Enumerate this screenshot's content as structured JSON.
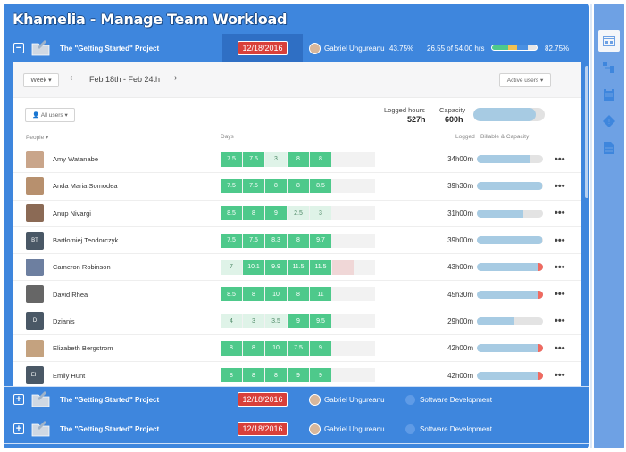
{
  "app": {
    "title": "Khamelia - Manage Team Workload"
  },
  "projects": [
    {
      "toggle": "−",
      "name": "The \"Getting Started\" Project",
      "date": "12/18/2016",
      "owner": "Gabriel Ungureanu",
      "percent": "43.75%",
      "hours": "26.55 of 54.00 hrs",
      "budget_pct": "82.75%",
      "budget_segments": {
        "green": 0.35,
        "yellow": 0.2,
        "blue": 0.25
      }
    },
    {
      "toggle": "+",
      "name": "The \"Getting Started\" Project",
      "date": "12/18/2016",
      "owner": "Gabriel Ungureanu",
      "department": "Software Development"
    },
    {
      "toggle": "+",
      "name": "The \"Getting Started\" Project",
      "date": "12/18/2016",
      "owner": "Gabriel Ungureanu",
      "department": "Software Development"
    }
  ],
  "toolbar": {
    "week_label": "Week ▾",
    "prev": "‹",
    "next": "›",
    "range": "Feb 18th - Feb 24th",
    "active_users": "Active users ▾"
  },
  "filters": {
    "all_users": "👤 All users ▾"
  },
  "summary": {
    "logged_label": "Logged hours",
    "logged_value": "527h",
    "capacity_label": "Capacity",
    "capacity_value": "600h",
    "capacity_fill": 0.88
  },
  "columns": {
    "people": "People ▾",
    "days": "Days",
    "logged": "Logged",
    "billable": "Billable & Capacity"
  },
  "people": [
    {
      "name": "Amy Watanabe",
      "initials": "",
      "avatar_color": "#c9a58a",
      "days": [
        {
          "v": "7.5",
          "s": "full"
        },
        {
          "v": "7.5",
          "s": "full"
        },
        {
          "v": "3",
          "s": "part"
        },
        {
          "v": "8",
          "s": "full"
        },
        {
          "v": "8",
          "s": "full"
        }
      ],
      "logged": "34h00m",
      "bar": 0.8,
      "over": false
    },
    {
      "name": "Anda Maria Somodea",
      "initials": "",
      "avatar_color": "#b7906e",
      "days": [
        {
          "v": "7.5",
          "s": "full"
        },
        {
          "v": "7.5",
          "s": "full"
        },
        {
          "v": "8",
          "s": "full"
        },
        {
          "v": "8",
          "s": "full"
        },
        {
          "v": "8.5",
          "s": "full"
        }
      ],
      "logged": "39h30m",
      "bar": 0.98,
      "over": false
    },
    {
      "name": "Anup Nivargi",
      "initials": "",
      "avatar_color": "#8b6a55",
      "days": [
        {
          "v": "8.5",
          "s": "full"
        },
        {
          "v": "8",
          "s": "full"
        },
        {
          "v": "9",
          "s": "full"
        },
        {
          "v": "2.5",
          "s": "part"
        },
        {
          "v": "3",
          "s": "part"
        }
      ],
      "logged": "31h00m",
      "bar": 0.7,
      "over": false
    },
    {
      "name": "Bartłomiej Teodorczyk",
      "initials": "BT",
      "avatar_color": "#4a5866",
      "days": [
        {
          "v": "7.5",
          "s": "full"
        },
        {
          "v": "7.5",
          "s": "full"
        },
        {
          "v": "8.3",
          "s": "full"
        },
        {
          "v": "8",
          "s": "full"
        },
        {
          "v": "9.7",
          "s": "full"
        }
      ],
      "logged": "39h00m",
      "bar": 0.98,
      "over": false
    },
    {
      "name": "Cameron Robinson",
      "initials": "",
      "avatar_color": "#6d7fa0",
      "days": [
        {
          "v": "7",
          "s": "part"
        },
        {
          "v": "10.1",
          "s": "full"
        },
        {
          "v": "9.9",
          "s": "full"
        },
        {
          "v": "11.5",
          "s": "full"
        },
        {
          "v": "11.5",
          "s": "full"
        },
        {
          "v": "",
          "s": "over"
        }
      ],
      "logged": "43h00m",
      "bar": 1.0,
      "over": true
    },
    {
      "name": "David Rhea",
      "initials": "",
      "avatar_color": "#666666",
      "days": [
        {
          "v": "8.5",
          "s": "full"
        },
        {
          "v": "8",
          "s": "full"
        },
        {
          "v": "10",
          "s": "full"
        },
        {
          "v": "8",
          "s": "full"
        },
        {
          "v": "11",
          "s": "full"
        }
      ],
      "logged": "45h30m",
      "bar": 1.0,
      "over": true
    },
    {
      "name": "Dzianis",
      "initials": "D",
      "avatar_color": "#4a5866",
      "days": [
        {
          "v": "4",
          "s": "part"
        },
        {
          "v": "3",
          "s": "part"
        },
        {
          "v": "3.5",
          "s": "part"
        },
        {
          "v": "9",
          "s": "full"
        },
        {
          "v": "9.5",
          "s": "full"
        }
      ],
      "logged": "29h00m",
      "bar": 0.57,
      "over": false
    },
    {
      "name": "Elizabeth Bergstrom",
      "initials": "",
      "avatar_color": "#c4a27f",
      "days": [
        {
          "v": "8",
          "s": "full"
        },
        {
          "v": "8",
          "s": "full"
        },
        {
          "v": "10",
          "s": "full"
        },
        {
          "v": "7.5",
          "s": "full"
        },
        {
          "v": "9",
          "s": "full"
        }
      ],
      "logged": "42h00m",
      "bar": 1.0,
      "over": true
    },
    {
      "name": "Emily Hunt",
      "initials": "EH",
      "avatar_color": "#4a5866",
      "days": [
        {
          "v": "8",
          "s": "full"
        },
        {
          "v": "8",
          "s": "full"
        },
        {
          "v": "8",
          "s": "full"
        },
        {
          "v": "9",
          "s": "full"
        },
        {
          "v": "9",
          "s": "full"
        }
      ],
      "logged": "42h00m",
      "bar": 1.0,
      "over": true
    }
  ],
  "more_label": "•••",
  "colors": {
    "accent": "#3e86dd",
    "selected": "#2f6fc4",
    "badge": "#d9403a",
    "full": "#4ec98b",
    "part": "#dff3e8",
    "over": "#f06a60",
    "bar": "#a7cbe3"
  },
  "right_icons": [
    "calendar-icon",
    "hierarchy-icon",
    "clipboard-icon",
    "alert-icon",
    "document-icon"
  ]
}
